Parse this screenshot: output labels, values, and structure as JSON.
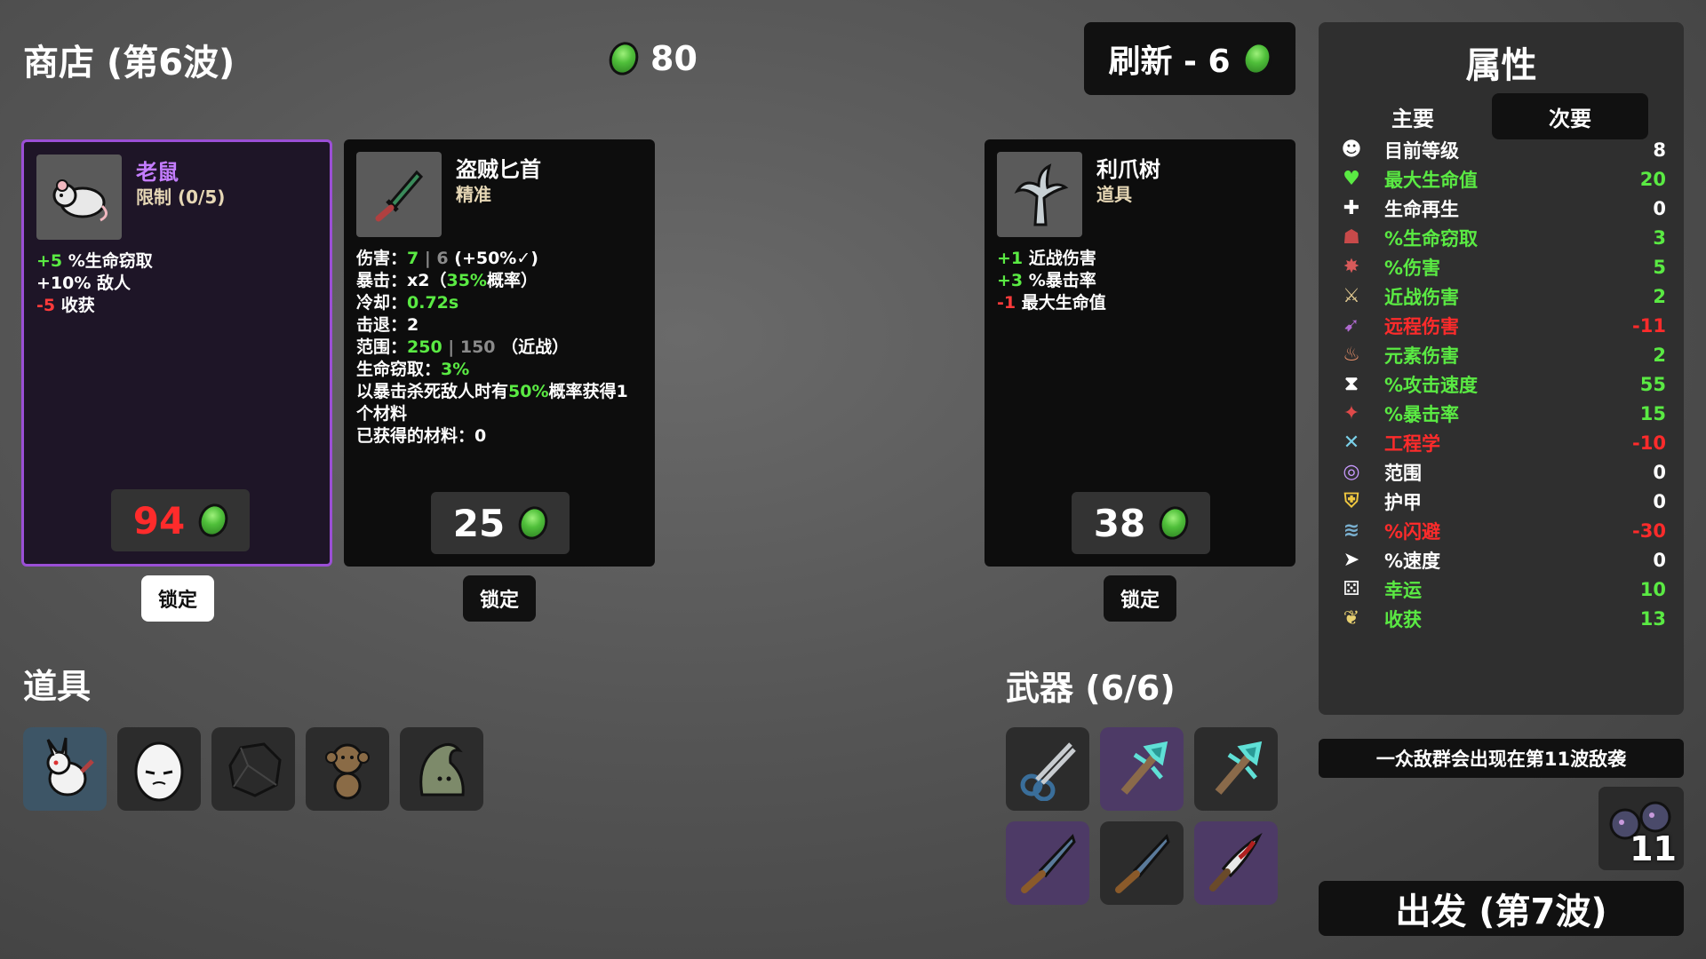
{
  "header": {
    "title": "商店 (第6波)",
    "materials": "80",
    "reroll_label": "刷新 - 6"
  },
  "shop_cards": [
    {
      "name": "老鼠",
      "type": "限制 (0/5)",
      "price": "94",
      "price_color": "#ff2b2b",
      "stats": [
        [
          {
            "t": "+5",
            "c": "green"
          },
          {
            "t": " %生命窃取"
          }
        ],
        [
          {
            "t": "+10% 敌人"
          }
        ],
        [
          {
            "t": "-5",
            "c": "red"
          },
          {
            "t": " 收获"
          }
        ]
      ],
      "lock_label": "锁定"
    },
    {
      "name": "盗贼匕首",
      "type": "精准",
      "price": "25",
      "price_color": "#ffffff",
      "stats": [
        [
          {
            "t": "伤害："
          },
          {
            "t": "7",
            "c": "green"
          },
          {
            "t": " | 6 ",
            "c": "gray"
          },
          {
            "t": "(+50%"
          },
          {
            "t": "✓"
          },
          {
            "t": ")"
          }
        ],
        [
          {
            "t": "暴击：x2（"
          },
          {
            "t": "35%",
            "c": "green"
          },
          {
            "t": "概率）"
          }
        ],
        [
          {
            "t": "冷却："
          },
          {
            "t": "0.72s",
            "c": "green"
          }
        ],
        [
          {
            "t": "击退：2"
          }
        ],
        [
          {
            "t": "范围："
          },
          {
            "t": "250",
            "c": "green"
          },
          {
            "t": " | 150 ",
            "c": "gray"
          },
          {
            "t": "（近战）"
          }
        ],
        [
          {
            "t": "生命窃取："
          },
          {
            "t": "3%",
            "c": "green"
          }
        ],
        [
          {
            "t": "以暴击杀死敌人时有"
          },
          {
            "t": "50%",
            "c": "green"
          },
          {
            "t": "概率获得1个材料"
          }
        ],
        [
          {
            "t": "已获得的材料：0"
          }
        ]
      ],
      "lock_label": "锁定"
    },
    {
      "name": "利爪树",
      "type": "道具",
      "price": "38",
      "price_color": "#ffffff",
      "stats": [
        [
          {
            "t": "+1",
            "c": "green"
          },
          {
            "t": " 近战伤害"
          }
        ],
        [
          {
            "t": "+3",
            "c": "green"
          },
          {
            "t": " %暴击率"
          }
        ],
        [
          {
            "t": "-1",
            "c": "red"
          },
          {
            "t": " 最大生命值"
          }
        ]
      ],
      "lock_label": "锁定"
    }
  ],
  "items_section": {
    "title": "道具",
    "slots": [
      "rabbit-icon",
      "egg-icon",
      "rock-icon",
      "monkey-icon",
      "hood-icon"
    ]
  },
  "weapons_section": {
    "title": "武器 (6/6)",
    "slots": [
      "scissors-icon",
      "wrench-icon",
      "wrench-icon",
      "knife-icon",
      "knife-icon",
      "bloody-knife-icon"
    ]
  },
  "stats_panel": {
    "title": "属性",
    "tabs": [
      "主要",
      "次要"
    ],
    "rows": [
      {
        "icon": "level-icon",
        "label": "目前等级",
        "value": "8",
        "color": "#ffffff"
      },
      {
        "icon": "heart-icon",
        "label": "最大生命值",
        "value": "20",
        "color": "#5aea43"
      },
      {
        "icon": "regen-icon",
        "label": "生命再生",
        "value": "0",
        "color": "#ffffff"
      },
      {
        "icon": "lifesteal-icon",
        "label": "%生命窃取",
        "value": "3",
        "color": "#5aea43"
      },
      {
        "icon": "damage-icon",
        "label": "%伤害",
        "value": "5",
        "color": "#5aea43"
      },
      {
        "icon": "melee-icon",
        "label": "近战伤害",
        "value": "2",
        "color": "#5aea43"
      },
      {
        "icon": "ranged-icon",
        "label": "远程伤害",
        "value": "-11",
        "color": "#ff2b2b"
      },
      {
        "icon": "elemental-icon",
        "label": "元素伤害",
        "value": "2",
        "color": "#5aea43"
      },
      {
        "icon": "attack-speed-icon",
        "label": "%攻击速度",
        "value": "55",
        "color": "#5aea43"
      },
      {
        "icon": "crit-icon",
        "label": "%暴击率",
        "value": "15",
        "color": "#5aea43"
      },
      {
        "icon": "engineering-icon",
        "label": "工程学",
        "value": "-10",
        "color": "#ff2b2b"
      },
      {
        "icon": "range-icon",
        "label": "范围",
        "value": "0",
        "color": "#ffffff"
      },
      {
        "icon": "armor-icon",
        "label": "护甲",
        "value": "0",
        "color": "#ffffff"
      },
      {
        "icon": "dodge-icon",
        "label": "%闪避",
        "value": "-30",
        "color": "#ff2b2b"
      },
      {
        "icon": "speed-icon",
        "label": "%速度",
        "value": "0",
        "color": "#ffffff"
      },
      {
        "icon": "luck-icon",
        "label": "幸运",
        "value": "10",
        "color": "#5aea43"
      },
      {
        "icon": "harvest-icon",
        "label": "收获",
        "value": "13",
        "color": "#5aea43"
      }
    ]
  },
  "wave_banner": "一众敌群会出现在第11波敌袭",
  "enemy_wave_number": "11",
  "go_button": "出发 (第7波)"
}
